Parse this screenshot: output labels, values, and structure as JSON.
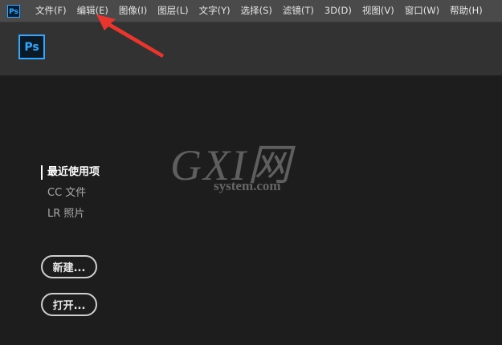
{
  "menubar": {
    "app_icon_label": "Ps",
    "items": [
      {
        "label": "文件(F)"
      },
      {
        "label": "编辑(E)"
      },
      {
        "label": "图像(I)"
      },
      {
        "label": "图层(L)"
      },
      {
        "label": "文字(Y)"
      },
      {
        "label": "选择(S)"
      },
      {
        "label": "滤镜(T)"
      },
      {
        "label": "3D(D)"
      },
      {
        "label": "视图(V)"
      },
      {
        "label": "窗口(W)"
      },
      {
        "label": "帮助(H)"
      }
    ]
  },
  "header": {
    "logo_label": "Ps"
  },
  "nav": {
    "items": [
      {
        "label": "最近使用项",
        "active": true
      },
      {
        "label": "CC 文件",
        "active": false
      },
      {
        "label": "LR 照片",
        "active": false
      }
    ]
  },
  "actions": {
    "new_label": "新建...",
    "open_label": "打开..."
  },
  "watermark": {
    "brand": "GXI网",
    "site": "system.com"
  },
  "colors": {
    "accent": "#31a8ff",
    "annotation_arrow": "#e8362e",
    "background": "#1d1d1d",
    "menubar": "#4a4a4a",
    "header": "#323232"
  }
}
